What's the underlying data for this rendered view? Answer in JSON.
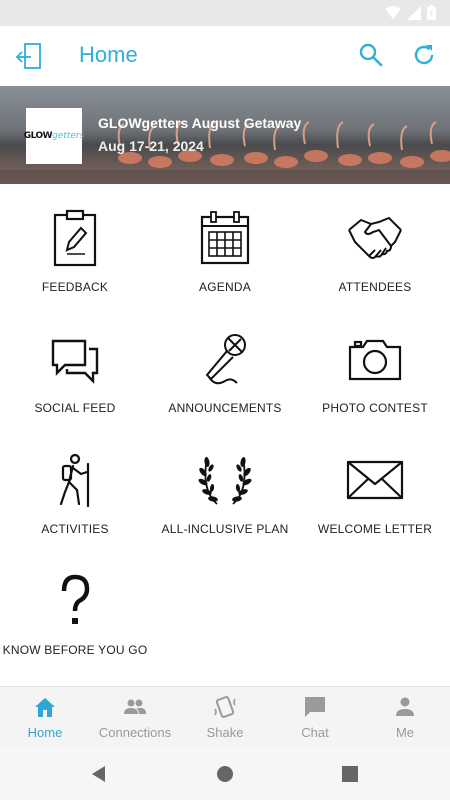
{
  "app": {
    "title": "Home",
    "accent": "#2fb0d8"
  },
  "header": {
    "back_icon": "exit-icon",
    "search_icon": "search-icon",
    "refresh_icon": "refresh-icon"
  },
  "banner": {
    "logo_text_bold": "GLOW",
    "logo_text_script": "getters",
    "event_title": "GLOWgetters August Getaway",
    "event_dates": "Aug 17-21, 2024"
  },
  "tiles": [
    {
      "label": "FEEDBACK",
      "icon": "clipboard-icon"
    },
    {
      "label": "AGENDA",
      "icon": "calendar-icon"
    },
    {
      "label": "ATTENDEES",
      "icon": "handshake-icon"
    },
    {
      "label": "SOCIAL FEED",
      "icon": "chat-bubbles-icon"
    },
    {
      "label": "ANNOUNCEMENTS",
      "icon": "microphone-icon"
    },
    {
      "label": "PHOTO CONTEST",
      "icon": "camera-icon"
    },
    {
      "label": "ACTIVITIES",
      "icon": "hiker-icon"
    },
    {
      "label": "ALL-INCLUSIVE PLAN",
      "icon": "laurel-icon"
    },
    {
      "label": "WELCOME LETTER",
      "icon": "envelope-icon"
    },
    {
      "label": "KNOW BEFORE YOU GO",
      "icon": "question-mark-icon"
    }
  ],
  "tabs": [
    {
      "label": "Home",
      "icon": "home-icon",
      "active": true
    },
    {
      "label": "Connections",
      "icon": "people-icon",
      "active": false
    },
    {
      "label": "Shake",
      "icon": "shake-phone-icon",
      "active": false
    },
    {
      "label": "Chat",
      "icon": "chat-icon",
      "active": false
    },
    {
      "label": "Me",
      "icon": "person-icon",
      "active": false
    }
  ],
  "colors": {
    "tab_active": "#2fa7d4",
    "tab_inactive": "#9a9a9a"
  }
}
